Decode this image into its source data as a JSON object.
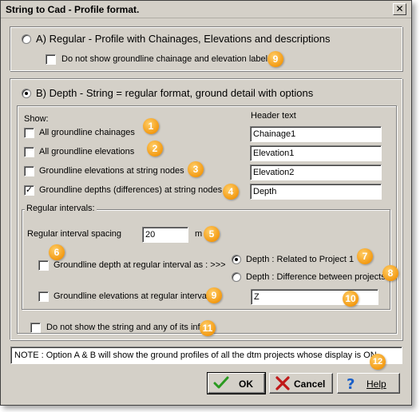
{
  "window": {
    "title": "String to Cad - Profile format.",
    "close_glyph": "✕"
  },
  "option_a": {
    "label": "A) Regular - Profile with Chainages, Elevations and descriptions",
    "selected": false,
    "sub_checkbox": {
      "label": "Do not show groundline chainage and elevation labels",
      "checked": false,
      "badge": "9"
    }
  },
  "option_b": {
    "label": "B) Depth -  String = regular format,    ground detail with options",
    "selected": true,
    "show_heading": "Show:",
    "header_heading": "Header text",
    "rows": [
      {
        "label": "All groundline chainages",
        "checked": false,
        "badge": "1",
        "header_value": "Chainage1"
      },
      {
        "label": "All groundline elevations",
        "checked": false,
        "badge": "2",
        "header_value": "Elevation1"
      },
      {
        "label": "Groundline elevations at string nodes",
        "checked": false,
        "badge": "3",
        "header_value": "Elevation2"
      },
      {
        "label": "Groundline depths (differences) at string nodes",
        "checked": true,
        "badge": "4",
        "header_value": "Depth"
      }
    ],
    "regular_intervals": {
      "legend": "Regular intervals:",
      "spacing_label": "Regular interval spacing",
      "spacing_value": "20",
      "spacing_unit": "m",
      "spacing_badge": "5",
      "depth_badge": "6",
      "depth_checkbox": {
        "label": "Groundline depth at regular interval as : >>>",
        "checked": false
      },
      "radio_related": {
        "label": "Depth : Related to Project 1",
        "selected": true,
        "badge": "7"
      },
      "radio_difference": {
        "label": "Depth : Difference between projects",
        "selected": false,
        "badge": "8"
      },
      "elev_checkbox": {
        "label": "Groundline elevations at regular intervals",
        "checked": false,
        "badge": "9"
      },
      "elev_header_value": "Z",
      "elev_header_badge": "10"
    },
    "hide_string": {
      "label": "Do not show the string and any of its info",
      "checked": false,
      "badge": "11"
    }
  },
  "note": {
    "text": "NOTE :  Option A & B will show the ground profiles of all the dtm projects whose display is ON",
    "badge": "12"
  },
  "buttons": {
    "ok": {
      "label": "OK",
      "icon": "checkmark-icon"
    },
    "cancel": {
      "label": "Cancel",
      "icon": "x-cross-icon"
    },
    "help": {
      "label": "Help",
      "icon": "question-mark-icon"
    }
  },
  "colors": {
    "face": "#d4d0c8",
    "badge": "#f39a12",
    "ok_check": "#2a9a20",
    "cancel_x": "#c01818",
    "help_q": "#1a5fc8"
  }
}
